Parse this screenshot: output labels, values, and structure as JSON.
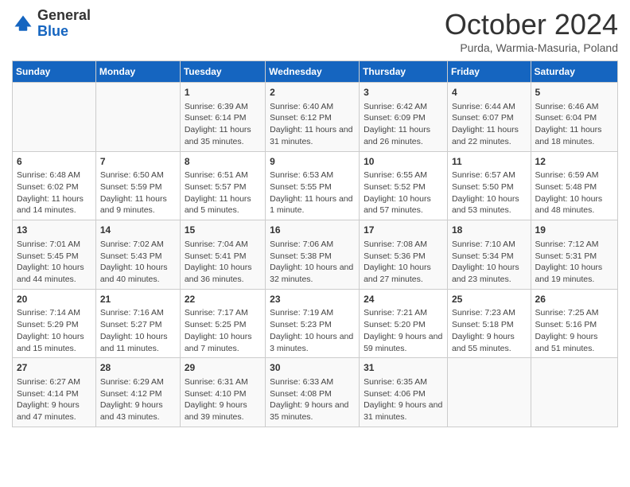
{
  "header": {
    "logo_line1": "General",
    "logo_line2": "Blue",
    "month_title": "October 2024",
    "location": "Purda, Warmia-Masuria, Poland"
  },
  "days_of_week": [
    "Sunday",
    "Monday",
    "Tuesday",
    "Wednesday",
    "Thursday",
    "Friday",
    "Saturday"
  ],
  "weeks": [
    [
      {
        "day": "",
        "info": ""
      },
      {
        "day": "",
        "info": ""
      },
      {
        "day": "1",
        "info": "Sunrise: 6:39 AM\nSunset: 6:14 PM\nDaylight: 11 hours and 35 minutes."
      },
      {
        "day": "2",
        "info": "Sunrise: 6:40 AM\nSunset: 6:12 PM\nDaylight: 11 hours and 31 minutes."
      },
      {
        "day": "3",
        "info": "Sunrise: 6:42 AM\nSunset: 6:09 PM\nDaylight: 11 hours and 26 minutes."
      },
      {
        "day": "4",
        "info": "Sunrise: 6:44 AM\nSunset: 6:07 PM\nDaylight: 11 hours and 22 minutes."
      },
      {
        "day": "5",
        "info": "Sunrise: 6:46 AM\nSunset: 6:04 PM\nDaylight: 11 hours and 18 minutes."
      }
    ],
    [
      {
        "day": "6",
        "info": "Sunrise: 6:48 AM\nSunset: 6:02 PM\nDaylight: 11 hours and 14 minutes."
      },
      {
        "day": "7",
        "info": "Sunrise: 6:50 AM\nSunset: 5:59 PM\nDaylight: 11 hours and 9 minutes."
      },
      {
        "day": "8",
        "info": "Sunrise: 6:51 AM\nSunset: 5:57 PM\nDaylight: 11 hours and 5 minutes."
      },
      {
        "day": "9",
        "info": "Sunrise: 6:53 AM\nSunset: 5:55 PM\nDaylight: 11 hours and 1 minute."
      },
      {
        "day": "10",
        "info": "Sunrise: 6:55 AM\nSunset: 5:52 PM\nDaylight: 10 hours and 57 minutes."
      },
      {
        "day": "11",
        "info": "Sunrise: 6:57 AM\nSunset: 5:50 PM\nDaylight: 10 hours and 53 minutes."
      },
      {
        "day": "12",
        "info": "Sunrise: 6:59 AM\nSunset: 5:48 PM\nDaylight: 10 hours and 48 minutes."
      }
    ],
    [
      {
        "day": "13",
        "info": "Sunrise: 7:01 AM\nSunset: 5:45 PM\nDaylight: 10 hours and 44 minutes."
      },
      {
        "day": "14",
        "info": "Sunrise: 7:02 AM\nSunset: 5:43 PM\nDaylight: 10 hours and 40 minutes."
      },
      {
        "day": "15",
        "info": "Sunrise: 7:04 AM\nSunset: 5:41 PM\nDaylight: 10 hours and 36 minutes."
      },
      {
        "day": "16",
        "info": "Sunrise: 7:06 AM\nSunset: 5:38 PM\nDaylight: 10 hours and 32 minutes."
      },
      {
        "day": "17",
        "info": "Sunrise: 7:08 AM\nSunset: 5:36 PM\nDaylight: 10 hours and 27 minutes."
      },
      {
        "day": "18",
        "info": "Sunrise: 7:10 AM\nSunset: 5:34 PM\nDaylight: 10 hours and 23 minutes."
      },
      {
        "day": "19",
        "info": "Sunrise: 7:12 AM\nSunset: 5:31 PM\nDaylight: 10 hours and 19 minutes."
      }
    ],
    [
      {
        "day": "20",
        "info": "Sunrise: 7:14 AM\nSunset: 5:29 PM\nDaylight: 10 hours and 15 minutes."
      },
      {
        "day": "21",
        "info": "Sunrise: 7:16 AM\nSunset: 5:27 PM\nDaylight: 10 hours and 11 minutes."
      },
      {
        "day": "22",
        "info": "Sunrise: 7:17 AM\nSunset: 5:25 PM\nDaylight: 10 hours and 7 minutes."
      },
      {
        "day": "23",
        "info": "Sunrise: 7:19 AM\nSunset: 5:23 PM\nDaylight: 10 hours and 3 minutes."
      },
      {
        "day": "24",
        "info": "Sunrise: 7:21 AM\nSunset: 5:20 PM\nDaylight: 9 hours and 59 minutes."
      },
      {
        "day": "25",
        "info": "Sunrise: 7:23 AM\nSunset: 5:18 PM\nDaylight: 9 hours and 55 minutes."
      },
      {
        "day": "26",
        "info": "Sunrise: 7:25 AM\nSunset: 5:16 PM\nDaylight: 9 hours and 51 minutes."
      }
    ],
    [
      {
        "day": "27",
        "info": "Sunrise: 6:27 AM\nSunset: 4:14 PM\nDaylight: 9 hours and 47 minutes."
      },
      {
        "day": "28",
        "info": "Sunrise: 6:29 AM\nSunset: 4:12 PM\nDaylight: 9 hours and 43 minutes."
      },
      {
        "day": "29",
        "info": "Sunrise: 6:31 AM\nSunset: 4:10 PM\nDaylight: 9 hours and 39 minutes."
      },
      {
        "day": "30",
        "info": "Sunrise: 6:33 AM\nSunset: 4:08 PM\nDaylight: 9 hours and 35 minutes."
      },
      {
        "day": "31",
        "info": "Sunrise: 6:35 AM\nSunset: 4:06 PM\nDaylight: 9 hours and 31 minutes."
      },
      {
        "day": "",
        "info": ""
      },
      {
        "day": "",
        "info": ""
      }
    ]
  ]
}
